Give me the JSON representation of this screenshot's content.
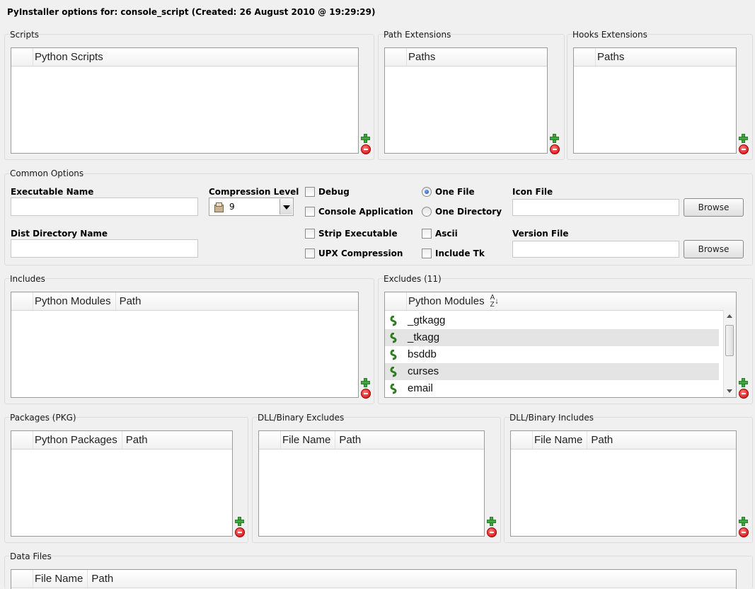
{
  "window": {
    "title": "PyInstaller options for: console_script (Created: 26 August 2010 @ 19:29:29)"
  },
  "scripts": {
    "label": "Scripts",
    "columns": [
      "Python Scripts"
    ]
  },
  "path_ext": {
    "label": "Path Extensions",
    "columns": [
      "Paths"
    ]
  },
  "hooks_ext": {
    "label": "Hooks Extensions",
    "columns": [
      "Paths"
    ]
  },
  "common": {
    "label": "Common Options",
    "exe_name_label": "Executable Name",
    "exe_name_value": "",
    "dist_dir_label": "Dist Directory Name",
    "dist_dir_value": "",
    "compression_label": "Compression Level",
    "compression_value": "9",
    "debug_label": "Debug",
    "console_app_label": "Console Application",
    "strip_label": "Strip Executable",
    "upx_label": "UPX Compression",
    "one_file_label": "One File",
    "one_dir_label": "One Directory",
    "ascii_label": "Ascii",
    "include_tk_label": "Include Tk",
    "icon_file_label": "Icon File",
    "icon_file_value": "",
    "version_file_label": "Version File",
    "version_file_value": "",
    "browse_label": "Browse"
  },
  "includes": {
    "label": "Includes",
    "columns": [
      "Python Modules",
      "Path"
    ]
  },
  "excludes": {
    "label": "Excludes (11)",
    "columns": [
      "Python Modules"
    ],
    "rows": [
      "_gtkagg",
      "_tkagg",
      "bsddb",
      "curses",
      "email"
    ]
  },
  "packages": {
    "label": "Packages (PKG)",
    "columns": [
      "Python Packages",
      "Path"
    ]
  },
  "dll_excludes": {
    "label": "DLL/Binary Excludes",
    "columns": [
      "File Name",
      "Path"
    ]
  },
  "dll_includes": {
    "label": "DLL/Binary Includes",
    "columns": [
      "File Name",
      "Path"
    ]
  },
  "data_files": {
    "label": "Data Files",
    "columns": [
      "File Name",
      "Path"
    ]
  },
  "colors": {
    "background": "#f0f0f0",
    "add": "#3fa73f",
    "remove": "#d10000",
    "alt_row": "#e4e4e4"
  }
}
